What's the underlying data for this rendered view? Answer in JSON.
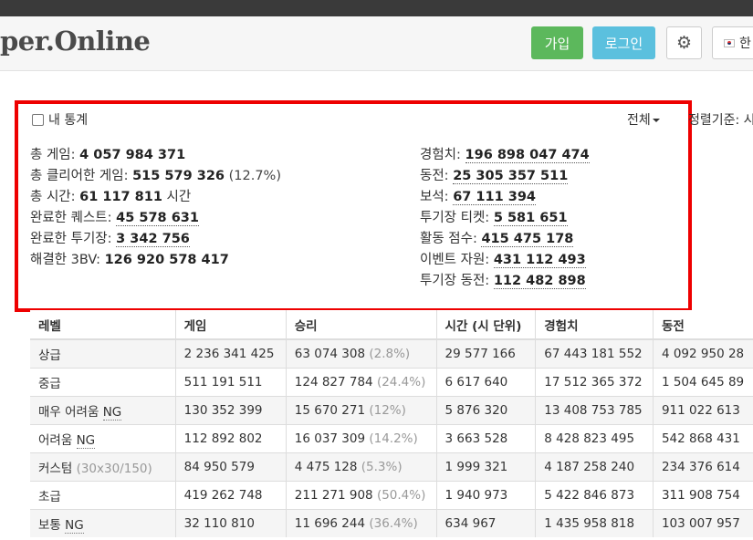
{
  "header": {
    "logo": "per.Online",
    "signup_label": "가입",
    "login_label": "로그인",
    "lang_label": "한",
    "settings_icon": "gear-icon",
    "colors": {
      "signup": "#5cb85c",
      "login": "#5bc0de",
      "highlight_border": "#ee0000"
    }
  },
  "stats": {
    "my_stats_label": "내 통계",
    "filter_label": "전체",
    "sort_label": "정렬기준: 시",
    "left": [
      {
        "label": "총 게임: ",
        "value": "4 057 984 371",
        "extra": ""
      },
      {
        "label": "총 클리어한 게임: ",
        "value": "515 579 326",
        "extra": " (12.7%)"
      },
      {
        "label": "총 시간: ",
        "value": "61 117 811",
        "extra": " 시간"
      },
      {
        "label": "완료한 퀘스트: ",
        "value": "45 578 631",
        "extra": ""
      },
      {
        "label": "완료한 투기장: ",
        "value": "3 342 756",
        "extra": ""
      },
      {
        "label": "해결한 3BV: ",
        "value": "126 920 578 417",
        "extra": ""
      }
    ],
    "right": [
      {
        "label": "경험치: ",
        "value": "196 898 047 474"
      },
      {
        "label": "동전: ",
        "value": "25 305 357 511"
      },
      {
        "label": "보석: ",
        "value": "67 111 394"
      },
      {
        "label": "투기장 티켓: ",
        "value": "5 581 651"
      },
      {
        "label": "활동 점수: ",
        "value": "415 475 178"
      },
      {
        "label": "이벤트 자원: ",
        "value": "431 112 493"
      },
      {
        "label": "투기장 동전: ",
        "value": "112 482 898"
      }
    ]
  },
  "table": {
    "headers": [
      "레벨",
      "게임",
      "승리",
      "시간 (시 단위)",
      "경험치",
      "동전"
    ],
    "rows": [
      {
        "level": "상급",
        "suffix": "",
        "games": "2 236 341 425",
        "wins": "63 074 308",
        "pct": " (2.8%)",
        "time": "29 577 166",
        "exp": "67 443 181 552",
        "coins": "4 092 950 28"
      },
      {
        "level": "중급",
        "suffix": "",
        "games": "511 191 511",
        "wins": "124 827 784",
        "pct": " (24.4%)",
        "time": "6 617 640",
        "exp": "17 512 365 372",
        "coins": "1 504 645 89"
      },
      {
        "level": "매우 어려움 ",
        "suffix": "NG",
        "games": "130 352 399",
        "wins": "15 670 271",
        "pct": " (12%)",
        "time": "5 876 320",
        "exp": "13 408 753 785",
        "coins": "911 022 613"
      },
      {
        "level": "어려움 ",
        "suffix": "NG",
        "games": "112 892 802",
        "wins": "16 037 309",
        "pct": " (14.2%)",
        "time": "3 663 528",
        "exp": "8 428 823 495",
        "coins": "542 868 431"
      },
      {
        "level": "커스텀 ",
        "suffix": "(30x30/150)",
        "games": "84 950 579",
        "wins": "4 475 128",
        "pct": " (5.3%)",
        "time": "1 999 321",
        "exp": "4 187 258 240",
        "coins": "234 376 614"
      },
      {
        "level": "초급",
        "suffix": "",
        "games": "419 262 748",
        "wins": "211 271 908",
        "pct": " (50.4%)",
        "time": "1 940 973",
        "exp": "5 422 846 873",
        "coins": "311 908 754"
      },
      {
        "level": "보통 ",
        "suffix": "NG",
        "games": "32 110 810",
        "wins": "11 696 244",
        "pct": " (36.4%)",
        "time": "634 967",
        "exp": "1 435 958 818",
        "coins": "103 007 957"
      }
    ]
  }
}
